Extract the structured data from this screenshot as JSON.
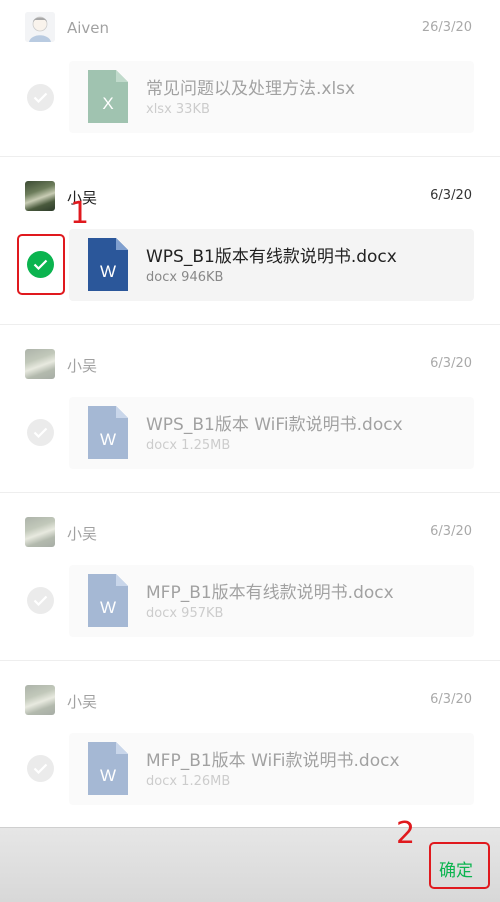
{
  "messages": [
    {
      "sender": "Aiven",
      "date": "26/3/20",
      "file_name": "常见问题以及处理方法.xlsx",
      "file_meta": "xlsx 33KB",
      "file_type": "xlsx-icon",
      "icon_letter": "X",
      "selected": false
    },
    {
      "sender": "小吴",
      "date": "6/3/20",
      "file_name": "WPS_B1版本有线款说明书.docx",
      "file_meta": "docx 946KB",
      "file_type": "docx-icon",
      "icon_letter": "W",
      "selected": true
    },
    {
      "sender": "小吴",
      "date": "6/3/20",
      "file_name": "WPS_B1版本 WiFi款说明书.docx",
      "file_meta": "docx 1.25MB",
      "file_type": "docx-icon",
      "icon_letter": "W",
      "selected": false
    },
    {
      "sender": "小吴",
      "date": "6/3/20",
      "file_name": "MFP_B1版本有线款说明书.docx",
      "file_meta": "docx 957KB",
      "file_type": "docx-icon",
      "icon_letter": "W",
      "selected": false
    },
    {
      "sender": "小吴",
      "date": "6/3/20",
      "file_name": "MFP_B1版本 WiFi款说明书.docx",
      "file_meta": "docx 1.26MB",
      "file_type": "docx-icon",
      "icon_letter": "W",
      "selected": false
    }
  ],
  "annotations": {
    "step1": "1",
    "step2": "2"
  },
  "bottom_bar": {
    "confirm_label": "确定"
  },
  "colors": {
    "accent": "#0bb44f",
    "annotation": "#e0191e",
    "word_blue": "#2b579a",
    "excel_green": "#1f7244"
  }
}
